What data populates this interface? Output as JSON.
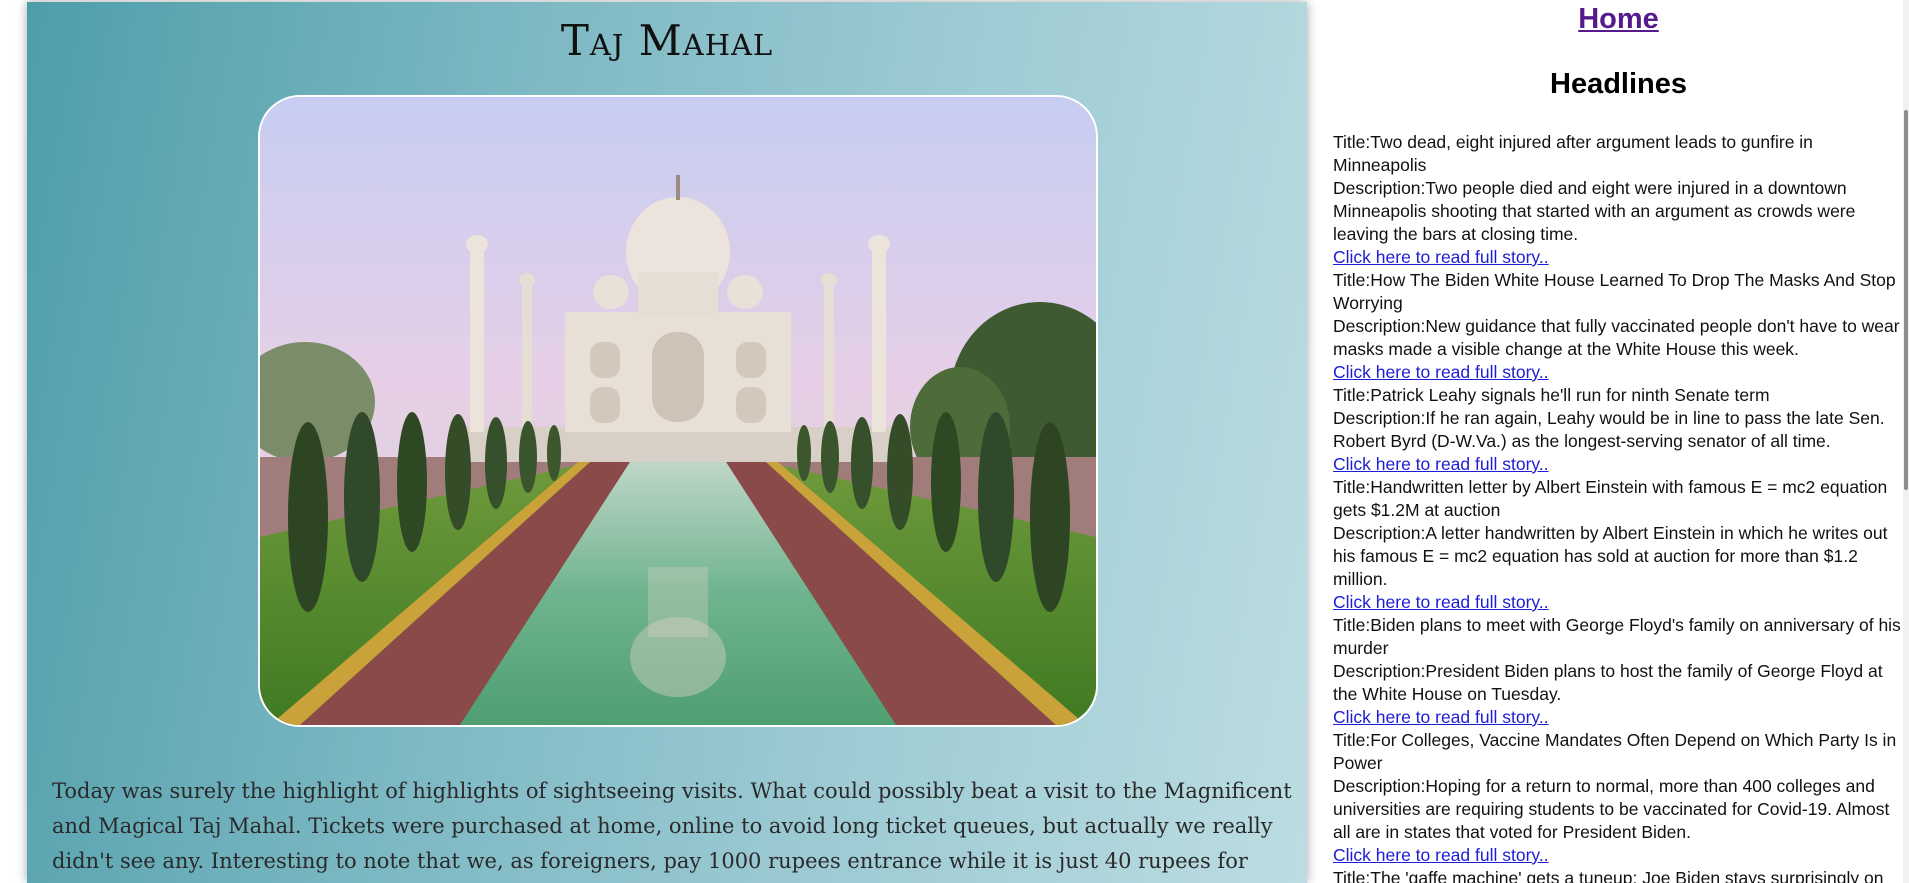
{
  "article": {
    "title": "Taj Mahal",
    "photo_alt": "Taj Mahal with reflecting pool",
    "body": "Today was surely the highlight of highlights of sightseeing visits. What could possibly beat a visit to the Magnificent and Magical Taj Mahal. Tickets were purchased at home, online to avoid long ticket queues, but actually we really didn't see any. Interesting to note that we, as foreigners, pay 1000 rupees entrance while it is just 40 rupees for Indians. Perfectly fair."
  },
  "sidebar": {
    "home_label": "Home",
    "headlines_title": "Headlines",
    "news": [
      {
        "title": "Title:Two dead, eight injured after argument leads to gunfire in Minneapolis",
        "description": "Description:Two people died and eight were injured in a downtown Minneapolis shooting that started with an argument as crowds were leaving the bars at closing time.",
        "link": "Click here to read full story.."
      },
      {
        "title": "Title:How The Biden White House Learned To Drop The Masks And Stop Worrying",
        "description": "Description:New guidance that fully vaccinated people don't have to wear masks made a visible change at the White House this week.",
        "link": "Click here to read full story.."
      },
      {
        "title": "Title:Patrick Leahy signals he'll run for ninth Senate term",
        "description": "Description:If he ran again, Leahy would be in line to pass the late Sen. Robert Byrd (D-W.Va.) as the longest-serving senator of all time.",
        "link": "Click here to read full story.."
      },
      {
        "title": "Title:Handwritten letter by Albert Einstein with famous E = mc2 equation gets $1.2M at auction",
        "description": "Description:A letter handwritten by Albert Einstein in which he writes out his famous E = mc2 equation has sold at auction for more than $1.2 million.",
        "link": "Click here to read full story.."
      },
      {
        "title": "Title:Biden plans to meet with George Floyd's family on anniversary of his murder",
        "description": "Description:President Biden plans to host the family of George Floyd at the White House on Tuesday.",
        "link": "Click here to read full story.."
      },
      {
        "title": "Title:For Colleges, Vaccine Mandates Often Depend on Which Party Is in Power",
        "description": "Description:Hoping for a return to normal, more than 400 colleges and universities are requiring students to be vaccinated for Covid-19. Almost all are in states that voted for President Biden.",
        "link": "Click here to read full story.."
      },
      {
        "title": "Title:The 'gaffe machine' gets a tuneup: Joe Biden stays surprisingly on",
        "description": "",
        "link": ""
      }
    ]
  }
}
